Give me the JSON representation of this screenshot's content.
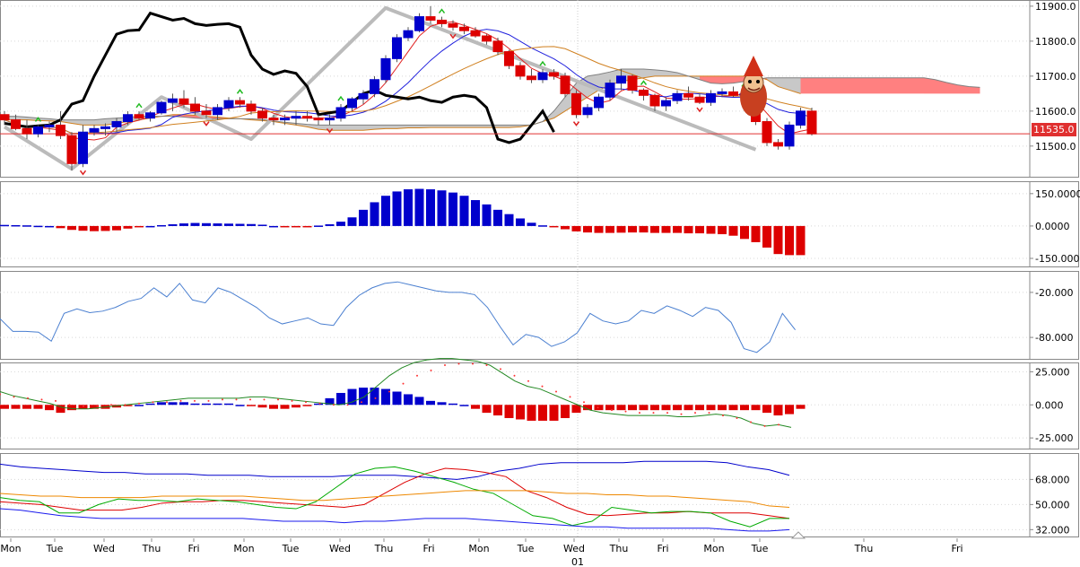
{
  "chart_data": [
    {
      "type": "candlestick",
      "panel": "price",
      "title": "",
      "yticks": [
        "11900.0",
        "11800.0",
        "11700.0",
        "11600.0",
        "11500.0"
      ],
      "ytick_values": [
        11900,
        11800,
        11700,
        11600,
        11500
      ],
      "ylim": [
        11420,
        11910
      ],
      "current_price_label": "11535.0",
      "current_price": 11535,
      "ohlc": [
        [
          11590,
          11600,
          11560,
          11575
        ],
        [
          11575,
          11590,
          11545,
          11550
        ],
        [
          11550,
          11575,
          11520,
          11535
        ],
        [
          11535,
          11560,
          11525,
          11555
        ],
        [
          11555,
          11570,
          11540,
          11560
        ],
        [
          11560,
          11600,
          11520,
          11530
        ],
        [
          11530,
          11540,
          11430,
          11450
        ],
        [
          11450,
          11560,
          11440,
          11540
        ],
        [
          11540,
          11560,
          11530,
          11550
        ],
        [
          11550,
          11565,
          11530,
          11555
        ],
        [
          11555,
          11580,
          11540,
          11570
        ],
        [
          11570,
          11600,
          11560,
          11590
        ],
        [
          11590,
          11600,
          11575,
          11580
        ],
        [
          11580,
          11600,
          11570,
          11595
        ],
        [
          11595,
          11630,
          11590,
          11625
        ],
        [
          11625,
          11650,
          11600,
          11635
        ],
        [
          11635,
          11660,
          11610,
          11620
        ],
        [
          11620,
          11640,
          11590,
          11600
        ],
        [
          11600,
          11620,
          11580,
          11590
        ],
        [
          11590,
          11620,
          11575,
          11610
        ],
        [
          11610,
          11640,
          11600,
          11630
        ],
        [
          11630,
          11640,
          11610,
          11620
        ],
        [
          11620,
          11630,
          11590,
          11600
        ],
        [
          11600,
          11610,
          11570,
          11580
        ],
        [
          11580,
          11590,
          11560,
          11575
        ],
        [
          11575,
          11590,
          11560,
          11580
        ],
        [
          11580,
          11600,
          11560,
          11585
        ],
        [
          11585,
          11600,
          11570,
          11580
        ],
        [
          11580,
          11590,
          11560,
          11575
        ],
        [
          11575,
          11590,
          11560,
          11580
        ],
        [
          11580,
          11620,
          11570,
          11610
        ],
        [
          11610,
          11640,
          11600,
          11635
        ],
        [
          11635,
          11660,
          11620,
          11650
        ],
        [
          11650,
          11700,
          11640,
          11690
        ],
        [
          11690,
          11760,
          11680,
          11750
        ],
        [
          11750,
          11820,
          11740,
          11810
        ],
        [
          11810,
          11840,
          11800,
          11830
        ],
        [
          11830,
          11880,
          11825,
          11870
        ],
        [
          11870,
          11900,
          11850,
          11860
        ],
        [
          11860,
          11870,
          11840,
          11850
        ],
        [
          11850,
          11860,
          11830,
          11840
        ],
        [
          11840,
          11850,
          11820,
          11830
        ],
        [
          11830,
          11840,
          11810,
          11815
        ],
        [
          11815,
          11820,
          11790,
          11800
        ],
        [
          11800,
          11810,
          11760,
          11770
        ],
        [
          11770,
          11775,
          11720,
          11730
        ],
        [
          11730,
          11740,
          11690,
          11700
        ],
        [
          11700,
          11720,
          11680,
          11690
        ],
        [
          11690,
          11720,
          11680,
          11710
        ],
        [
          11710,
          11720,
          11690,
          11700
        ],
        [
          11700,
          11710,
          11640,
          11650
        ],
        [
          11650,
          11660,
          11580,
          11590
        ],
        [
          11590,
          11620,
          11580,
          11610
        ],
        [
          11610,
          11650,
          11600,
          11640
        ],
        [
          11640,
          11690,
          11630,
          11680
        ],
        [
          11680,
          11720,
          11660,
          11700
        ],
        [
          11700,
          11705,
          11650,
          11660
        ],
        [
          11660,
          11665,
          11630,
          11645
        ],
        [
          11645,
          11650,
          11600,
          11615
        ],
        [
          11615,
          11640,
          11600,
          11630
        ],
        [
          11630,
          11660,
          11620,
          11650
        ],
        [
          11650,
          11670,
          11630,
          11640
        ],
        [
          11640,
          11650,
          11620,
          11625
        ],
        [
          11625,
          11660,
          11615,
          11650
        ],
        [
          11650,
          11665,
          11640,
          11655
        ],
        [
          11655,
          11670,
          11640,
          11645
        ],
        [
          11645,
          11660,
          11630,
          11650
        ],
        [
          11650,
          11655,
          11560,
          11570
        ],
        [
          11570,
          11580,
          11500,
          11510
        ],
        [
          11510,
          11520,
          11490,
          11500
        ],
        [
          11500,
          11570,
          11490,
          11560
        ],
        [
          11560,
          11610,
          11550,
          11600
        ],
        [
          11600,
          11610,
          11530,
          11535
        ]
      ],
      "lines": {
        "black": [
          11565,
          11560,
          11555,
          11558,
          11560,
          11575,
          11620,
          11630,
          11700,
          11760,
          11820,
          11830,
          11832,
          11880,
          11870,
          11860,
          11865,
          11850,
          11845,
          11848,
          11850,
          11840,
          11760,
          11720,
          11705,
          11715,
          11708,
          11670,
          11590,
          11595,
          11600,
          11625,
          11650,
          11660,
          11645,
          11640,
          11635,
          11640,
          11630,
          11625,
          11640,
          11645,
          11640,
          11610,
          11520,
          11510,
          11520,
          11560,
          11600,
          11540
        ]
      },
      "cloud": {
        "span_a": [
          11575,
          11575,
          11575,
          11573,
          11572,
          11570,
          11565,
          11560,
          11560,
          11560,
          11565,
          11570,
          11575,
          11580,
          11585,
          11590,
          11590,
          11588,
          11585,
          11583,
          11580,
          11578,
          11575,
          11573,
          11570,
          11565,
          11560,
          11555,
          11548,
          11545,
          11545,
          11545,
          11545,
          11548,
          11550,
          11550,
          11552,
          11552,
          11553,
          11553,
          11553,
          11553,
          11553,
          11553,
          11553,
          11553,
          11555,
          11560,
          11570,
          11580,
          11600,
          11620,
          11640,
          11660,
          11675,
          11685,
          11690,
          11695,
          11700,
          11700,
          11700,
          11700,
          11700,
          11700,
          11700,
          11700,
          11700,
          11700,
          11690,
          11670,
          11660,
          11650
        ],
        "span_b": [
          11585,
          11585,
          11583,
          11580,
          11578,
          11575,
          11575,
          11575,
          11575,
          11578,
          11580,
          11582,
          11585,
          11585,
          11585,
          11585,
          11583,
          11580,
          11578,
          11578,
          11578,
          11578,
          11578,
          11576,
          11572,
          11568,
          11565,
          11562,
          11560,
          11560,
          11560,
          11560,
          11560,
          11560,
          11560,
          11560,
          11560,
          11560,
          11560,
          11560,
          11560,
          11560,
          11560,
          11560,
          11560,
          11560,
          11560,
          11560,
          11570,
          11600,
          11640,
          11680,
          11700,
          11705,
          11712,
          11720,
          11720,
          11720,
          11718,
          11715,
          11710,
          11700,
          11690,
          11680,
          11678,
          11680,
          11685,
          11690,
          11695,
          11695,
          11695,
          11695,
          11695,
          11695,
          11695,
          11695,
          11695,
          11695,
          11695,
          11695,
          11695,
          11695,
          11695,
          11690,
          11682,
          11675,
          11670,
          11668
        ]
      }
    },
    {
      "type": "bar",
      "panel": "oscillator-1",
      "yticks": [
        "150.0000",
        "0.0000",
        "-150.0000"
      ],
      "ylim": [
        -175,
        195
      ],
      "values": [
        5,
        4,
        3,
        1,
        0,
        -10,
        -18,
        -22,
        -24,
        -23,
        -20,
        -12,
        -5,
        0,
        4,
        8,
        12,
        14,
        13,
        12,
        11,
        10,
        9,
        6,
        0,
        -3,
        -4,
        -2,
        2,
        8,
        20,
        40,
        75,
        110,
        140,
        160,
        170,
        172,
        170,
        165,
        155,
        140,
        120,
        100,
        75,
        55,
        35,
        15,
        3,
        -5,
        -15,
        -25,
        -30,
        -32,
        -32,
        -31,
        -30,
        -30,
        -32,
        -32,
        -32,
        -34,
        -34,
        -36,
        -38,
        -45,
        -60,
        -75,
        -100,
        -130,
        -135,
        -135
      ],
      "bar_colors": [
        "#0000cc",
        "#dd0000"
      ]
    },
    {
      "type": "line",
      "panel": "oscillator-2",
      "yticks": [
        "-20.000",
        "-80.000"
      ],
      "ylim": [
        -105,
        5
      ],
      "values": [
        -55,
        -72,
        -72,
        -73,
        -85,
        -48,
        -42,
        -47,
        -45,
        -40,
        -32,
        -28,
        -14,
        -26,
        -8,
        -30,
        -34,
        -14,
        -20,
        -30,
        -40,
        -54,
        -62,
        -58,
        -54,
        -62,
        -64,
        -40,
        -24,
        -14,
        -8,
        -6,
        -10,
        -14,
        -18,
        -20,
        -20,
        -23,
        -40,
        -66,
        -90,
        -76,
        -80,
        -92,
        -86,
        -74,
        -48,
        -58,
        -62,
        -58,
        -44,
        -48,
        -38,
        -44,
        -52,
        -40,
        -44,
        -60,
        -95,
        -100,
        -86,
        -48,
        -70
      ]
    },
    {
      "type": "bar",
      "panel": "oscillator-3",
      "yticks": [
        "25.000",
        "0.000",
        "-25.000"
      ],
      "ylim": [
        -31,
        30
      ],
      "values": [
        -3,
        -3,
        -3,
        -3,
        -4,
        -6,
        -4,
        -3,
        -3,
        -3,
        -2,
        -1,
        0,
        1,
        2,
        2,
        2,
        1,
        1,
        1,
        1,
        0,
        -1,
        -2,
        -3,
        -3,
        -2,
        -1,
        1,
        5,
        9,
        12,
        13,
        13,
        12,
        10,
        8,
        6,
        3,
        2,
        1,
        0,
        -3,
        -6,
        -8,
        -10,
        -11,
        -12,
        -12,
        -12,
        -10,
        -6,
        -4,
        -4,
        -4,
        -4,
        -4,
        -4,
        -4,
        -4,
        -4,
        -4,
        -4,
        -4,
        -4,
        -4,
        -4,
        -4,
        -6,
        -8,
        -7,
        -3
      ],
      "bar_colors": [
        "#0000cc",
        "#dd0000"
      ],
      "line_green": [
        10,
        7,
        5,
        3,
        1,
        -2,
        -3,
        -3,
        -2,
        -1,
        0,
        1,
        2,
        3,
        4,
        5,
        5,
        5,
        5,
        5,
        6,
        6,
        5,
        4,
        3,
        2,
        1,
        0,
        2,
        6,
        14,
        22,
        28,
        32,
        34,
        35,
        35,
        34,
        33,
        30,
        24,
        18,
        14,
        12,
        8,
        4,
        0,
        -4,
        -6,
        -7,
        -8,
        -8,
        -8,
        -8,
        -9,
        -9,
        -8,
        -7,
        -8,
        -10,
        -14,
        -16,
        -15,
        -17
      ],
      "dots_red": [
        8,
        6,
        5,
        4,
        3,
        0,
        -1,
        -1,
        0,
        0,
        1,
        2,
        2,
        3,
        3,
        3,
        4,
        4,
        4,
        4,
        4,
        3,
        2,
        1,
        0,
        0,
        2,
        5,
        10,
        16,
        22,
        26,
        30,
        31,
        31,
        30,
        27,
        22,
        18,
        14,
        10,
        6,
        2,
        -2,
        -4,
        -5,
        -6,
        -6,
        -6,
        -7,
        -6,
        -6,
        -8,
        -10,
        -13,
        -16,
        -15
      ]
    },
    {
      "type": "line",
      "panel": "oscillator-4",
      "yticks": [
        "68.000",
        "50.000",
        "32.000"
      ],
      "ylim": [
        29,
        85
      ],
      "series": [
        {
          "color": "#0000cc",
          "values": [
            79,
            77,
            76,
            75,
            74,
            73,
            73,
            72,
            72,
            72,
            71,
            71,
            71,
            70,
            70,
            70,
            70,
            71,
            71,
            71,
            70,
            69,
            68,
            70,
            74,
            76,
            79,
            80,
            80,
            80,
            80,
            81,
            81,
            81,
            81,
            80,
            77,
            75,
            71
          ]
        },
        {
          "color": "#dd0000",
          "values": [
            52,
            51,
            50,
            48,
            46,
            46,
            46,
            48,
            51,
            52,
            52,
            53,
            53,
            52,
            51,
            50,
            49,
            48,
            50,
            58,
            66,
            72,
            76,
            75,
            73,
            70,
            60,
            55,
            48,
            43,
            42,
            43,
            44,
            44,
            45,
            44,
            44,
            44,
            42,
            40
          ]
        },
        {
          "color": "#00aa00",
          "values": [
            55,
            53,
            52,
            44,
            44,
            50,
            54,
            53,
            53,
            52,
            54,
            53,
            52,
            50,
            48,
            47,
            52,
            62,
            72,
            76,
            77,
            74,
            70,
            66,
            61,
            58,
            50,
            42,
            40,
            35,
            38,
            48,
            46,
            44,
            45,
            45,
            44,
            38,
            34,
            40,
            40
          ]
        },
        {
          "color": "#ee8800",
          "values": [
            58,
            57,
            56,
            56,
            55,
            55,
            55,
            55,
            56,
            56,
            56,
            56,
            56,
            55,
            54,
            53,
            53,
            54,
            55,
            56,
            57,
            58,
            59,
            60,
            60,
            60,
            60,
            59,
            58,
            58,
            57,
            57,
            56,
            56,
            55,
            54,
            53,
            52,
            49,
            48
          ]
        },
        {
          "color": "#1a1aee",
          "values": [
            47,
            46,
            44,
            42,
            41,
            40,
            40,
            40,
            40,
            40,
            40,
            40,
            40,
            39,
            38,
            38,
            38,
            37,
            38,
            38,
            39,
            40,
            40,
            40,
            39,
            38,
            37,
            36,
            35,
            34,
            34,
            33,
            33,
            33,
            33,
            33,
            32,
            31,
            31,
            32
          ]
        }
      ]
    }
  ],
  "xaxis": {
    "labels": [
      "Mon",
      "Tue",
      "Wed",
      "Thu",
      "Fri",
      "Mon",
      "Tue",
      "Wed",
      "Thu",
      "Fri",
      "Mon",
      "Tue",
      "Wed",
      "Thu",
      "Fri",
      "Mon",
      "Tue",
      "Thu",
      "Fri"
    ],
    "sub_label": "01"
  },
  "colors": {
    "up": "#0000cc",
    "down": "#dd0000",
    "cloud_bull": "#c8c8c8",
    "cloud_bear": "#ff8080",
    "grid": "#e0e0e0"
  }
}
